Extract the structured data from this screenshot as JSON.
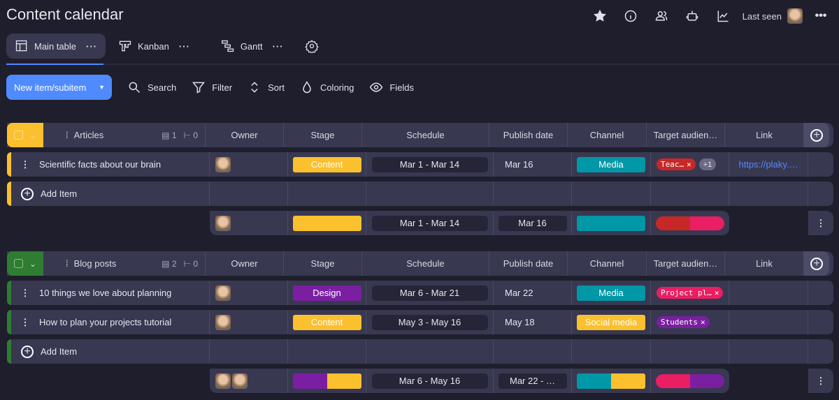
{
  "header": {
    "title": "Content calendar",
    "last_seen": "Last seen"
  },
  "tabs": [
    {
      "label": "Main table",
      "active": true
    },
    {
      "label": "Kanban"
    },
    {
      "label": "Gantt"
    }
  ],
  "toolbar": {
    "new_item": "New item/subitem",
    "search": "Search",
    "filter": "Filter",
    "sort": "Sort",
    "coloring": "Coloring",
    "fields": "Fields"
  },
  "columns": [
    "Owner",
    "Stage",
    "Schedule",
    "Publish date",
    "Channel",
    "Target audien…",
    "Link"
  ],
  "add_item": "Add Item",
  "colors": {
    "yellow": "#fbc02d",
    "green": "#2e7d32",
    "teal": "#0097a7",
    "purple": "#7b1fa2",
    "red": "#c62828",
    "pink": "#e91e63",
    "accent": "#4f8bff"
  },
  "groups": [
    {
      "name": "Articles",
      "color": "#fbc02d",
      "items_count": "1",
      "subitems_count": "0",
      "rows": [
        {
          "name": "Scientific facts about our brain",
          "stage": "Content",
          "stage_color": "#fbc02d",
          "schedule": "Mar 1 - Mar 14",
          "publish": "Mar 16",
          "channel": "Media",
          "channel_color": "#0097a7",
          "tags": [
            {
              "label": "Teac…",
              "color": "#c62828"
            }
          ],
          "more": "+1",
          "link": "https://plaky.…"
        }
      ],
      "summary": {
        "owners": 1,
        "stage_colors": [
          "#fbc02d"
        ],
        "schedule": "Mar 1 - Mar 14",
        "publish": "Mar 16",
        "channel_colors": [
          "#0097a7"
        ],
        "tag_colors": [
          "#c62828",
          "#e91e63"
        ]
      }
    },
    {
      "name": "Blog posts",
      "color": "#2e7d32",
      "items_count": "2",
      "subitems_count": "0",
      "rows": [
        {
          "name": "10 things we love about planning",
          "stage": "Design",
          "stage_color": "#7b1fa2",
          "schedule": "Mar 6 - Mar 21",
          "publish": "Mar 22",
          "channel": "Media",
          "channel_color": "#0097a7",
          "tags": [
            {
              "label": "Project pl…",
              "color": "#e91e63"
            }
          ],
          "more": null,
          "link": ""
        },
        {
          "name": "How to plan your projects tutorial",
          "stage": "Content",
          "stage_color": "#fbc02d",
          "schedule": "May 3 - May 16",
          "publish": "May 18",
          "channel": "Social media",
          "channel_color": "#fbc02d",
          "tags": [
            {
              "label": "Students",
              "color": "#7b1fa2"
            }
          ],
          "more": null,
          "link": ""
        }
      ],
      "summary": {
        "owners": 2,
        "stage_colors": [
          "#7b1fa2",
          "#fbc02d"
        ],
        "schedule": "Mar 6 - May 16",
        "publish": "Mar 22 - …",
        "channel_colors": [
          "#0097a7",
          "#fbc02d"
        ],
        "tag_colors": [
          "#e91e63",
          "#7b1fa2"
        ]
      }
    }
  ]
}
